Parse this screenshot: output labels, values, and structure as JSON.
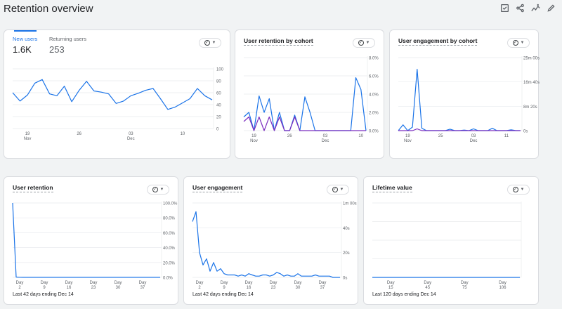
{
  "page": {
    "title": "Retention overview"
  },
  "toolbar": {
    "icons": [
      "compare-report-icon",
      "share-icon",
      "insights-icon",
      "edit-icon"
    ]
  },
  "colors": {
    "primary_series": "#1a73e8",
    "secondary_series": "#7b2cbf",
    "grid": "#e8eaed"
  },
  "cards": {
    "new_users": {
      "tabs": [
        {
          "label": "New users",
          "value": "1.6K"
        },
        {
          "label": "Returning users",
          "value": "253"
        }
      ]
    },
    "cohort_retention": {
      "title": "User retention by cohort"
    },
    "cohort_engagement": {
      "title": "User engagement by cohort"
    },
    "user_retention": {
      "title": "User retention",
      "footer": "Last 42 days ending Dec 14"
    },
    "user_engagement": {
      "title": "User engagement",
      "footer": "Last 42 days ending Dec 14"
    },
    "lifetime_value": {
      "title": "Lifetime value",
      "footer": "Last 120 days ending Dec 14"
    }
  },
  "chart_data": [
    {
      "id": "new_users",
      "type": "line",
      "xlabels": [
        [
          "19",
          "Nov"
        ],
        [
          "26",
          ""
        ],
        [
          "03",
          "Dec"
        ],
        [
          "10",
          ""
        ]
      ],
      "xlabel_at": [
        2,
        9,
        16,
        23
      ],
      "yticks": [
        "100",
        "80",
        "60",
        "40",
        "20",
        "0"
      ],
      "ylim": [
        0,
        100
      ],
      "series": [
        {
          "values": [
            60,
            46,
            56,
            76,
            82,
            58,
            55,
            71,
            45,
            64,
            79,
            63,
            61,
            58,
            42,
            46,
            55,
            59,
            64,
            67,
            50,
            32,
            36,
            43,
            50,
            67,
            55,
            48
          ]
        }
      ]
    },
    {
      "id": "cohort_retention",
      "type": "line",
      "xlabels": [
        [
          "19",
          "Nov"
        ],
        [
          "26",
          ""
        ],
        [
          "03",
          "Dec"
        ],
        [
          "10",
          ""
        ]
      ],
      "xlabel_at": [
        2,
        9,
        16,
        23
      ],
      "yticks": [
        "8.0%",
        "6.0%",
        "4.0%",
        "2.0%",
        "0.0%"
      ],
      "ylim": [
        0,
        8
      ],
      "series": [
        {
          "values": [
            1.5,
            2.0,
            0.0,
            3.8,
            2.0,
            3.5,
            0.0,
            2.0,
            0.0,
            0.0,
            1.7,
            0.0,
            3.7,
            2.0,
            0.0,
            0.0,
            0.0,
            0.0,
            0.0,
            0.0,
            0.0,
            0.0,
            5.8,
            4.5,
            0.0
          ]
        },
        {
          "values": [
            1.0,
            1.5,
            0.0,
            1.5,
            0.0,
            1.5,
            0.0,
            1.5,
            0.0,
            0.0,
            1.5,
            0.0,
            0.0,
            0.0,
            0.0,
            0.0,
            0.0,
            0.0,
            0.0,
            0.0,
            0.0,
            0.0,
            0.0,
            0.0,
            0.0
          ]
        }
      ]
    },
    {
      "id": "cohort_engagement",
      "type": "line",
      "xlabels": [
        [
          "19",
          "Nov"
        ],
        [
          "25",
          ""
        ],
        [
          "03",
          "Dec"
        ],
        [
          "11",
          ""
        ]
      ],
      "xlabel_at": [
        2,
        9,
        16,
        23
      ],
      "yticks": [
        "25m 00s",
        "16m 40s",
        "8m 20s",
        "0s"
      ],
      "ylim": [
        0,
        25
      ],
      "series": [
        {
          "values": [
            0,
            2,
            0,
            1.2,
            21,
            0.8,
            0,
            0,
            0,
            0,
            0,
            0.5,
            0,
            0,
            0.2,
            0,
            0.6,
            0,
            0,
            0,
            0.8,
            0,
            0,
            0,
            0.3,
            0,
            0
          ]
        },
        {
          "values": [
            0,
            0,
            0,
            0,
            0.6,
            0,
            0,
            0,
            0,
            0,
            0,
            0,
            0,
            0,
            0,
            0,
            0,
            0,
            0,
            0,
            0,
            0,
            0,
            0,
            0,
            0,
            0
          ]
        }
      ]
    },
    {
      "id": "user_retention",
      "type": "line",
      "xlabels": [
        [
          "Day",
          "2"
        ],
        [
          "Day",
          "9"
        ],
        [
          "Day",
          "16"
        ],
        [
          "Day",
          "23"
        ],
        [
          "Day",
          "30"
        ],
        [
          "Day",
          "37"
        ]
      ],
      "xlabel_at": [
        2,
        9,
        16,
        23,
        30,
        37
      ],
      "yticks": [
        "100.0%",
        "80.0%",
        "60.0%",
        "40.0%",
        "20.0%",
        "0.0%"
      ],
      "ylim": [
        0,
        100
      ],
      "series": [
        {
          "values": [
            100,
            0.5,
            0.2,
            0.1,
            0.2,
            0.1,
            0.1,
            0.1,
            0.1,
            0.1,
            0.1,
            0.1,
            0.1,
            0.1,
            0.1,
            0.1,
            0.1,
            0.1,
            0.1,
            0.1,
            0.1,
            0.1,
            0.1,
            0.1,
            0.1,
            0.1,
            0.1,
            0.1,
            0.1,
            0.1,
            0.1,
            0.1,
            0.1,
            0.1,
            0.1,
            0.1,
            0.1,
            0.1,
            0.1,
            0.1,
            0.1,
            0.1,
            0.1
          ]
        }
      ]
    },
    {
      "id": "user_engagement",
      "type": "line",
      "xlabels": [
        [
          "Day",
          "2"
        ],
        [
          "Day",
          "9"
        ],
        [
          "Day",
          "16"
        ],
        [
          "Day",
          "23"
        ],
        [
          "Day",
          "30"
        ],
        [
          "Day",
          "37"
        ]
      ],
      "xlabel_at": [
        2,
        9,
        16,
        23,
        30,
        37
      ],
      "yticks": [
        "1m 00s",
        "40s",
        "20s",
        "0s"
      ],
      "ylim": [
        0,
        60
      ],
      "series": [
        {
          "values": [
            45,
            53,
            20,
            10,
            15,
            5,
            12,
            5,
            7,
            3,
            2,
            2,
            2,
            1,
            2,
            1,
            3,
            2,
            1,
            1,
            2,
            2,
            1,
            2,
            4,
            3,
            1,
            2,
            1,
            1,
            3,
            1,
            1,
            1,
            1,
            2,
            1,
            1,
            1,
            1,
            0,
            0,
            0
          ]
        }
      ]
    },
    {
      "id": "lifetime_value",
      "type": "line",
      "xlabels": [
        [
          "Day",
          "15"
        ],
        [
          "Day",
          "45"
        ],
        [
          "Day",
          "75"
        ],
        [
          "Day",
          "106"
        ]
      ],
      "xlabel_at": [
        15,
        45,
        75,
        106
      ],
      "yticks": [],
      "ylim": [
        0,
        1
      ],
      "xmax": 120,
      "series": [
        {
          "values": [
            0,
            0,
            0,
            0,
            0,
            0,
            0,
            0,
            0,
            0,
            0,
            0,
            0
          ]
        }
      ]
    }
  ]
}
